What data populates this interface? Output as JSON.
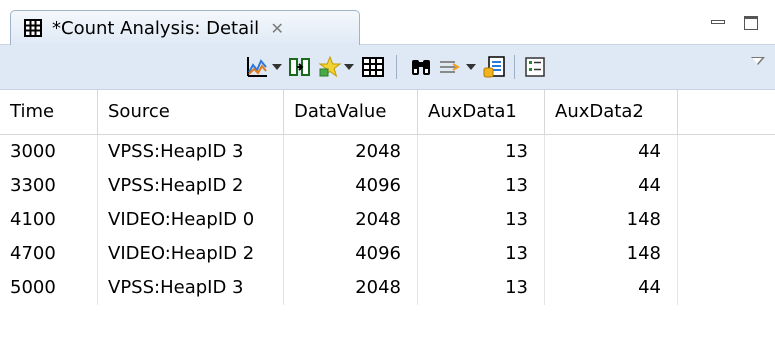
{
  "tab": {
    "title": "*Count Analysis: Detail",
    "icon": "table-icon",
    "close": "✕"
  },
  "window_controls": [
    "minimize",
    "maximize"
  ],
  "toolbar": {
    "icons": [
      "graph-icon",
      "columns-icon",
      "highlight-icon",
      "table-view-icon",
      "find-icon",
      "filter-icon",
      "export-icon",
      "group-icon",
      "view-menu-icon"
    ]
  },
  "table": {
    "columns": [
      "Time",
      "Source",
      "DataValue",
      "AuxData1",
      "AuxData2"
    ],
    "rows": [
      {
        "time": "3000",
        "source": "VPSS:HeapID 3",
        "datavalue": "2048",
        "aux1": "13",
        "aux2": "44"
      },
      {
        "time": "3300",
        "source": "VPSS:HeapID 2",
        "datavalue": "4096",
        "aux1": "13",
        "aux2": "44"
      },
      {
        "time": "4100",
        "source": "VIDEO:HeapID 0",
        "datavalue": "2048",
        "aux1": "13",
        "aux2": "148"
      },
      {
        "time": "4700",
        "source": "VIDEO:HeapID 2",
        "datavalue": "4096",
        "aux1": "13",
        "aux2": "148"
      },
      {
        "time": "5000",
        "source": "VPSS:HeapID 3",
        "datavalue": "2048",
        "aux1": "13",
        "aux2": "44"
      }
    ]
  },
  "colors": {
    "tab_bg": "#dfe9f5",
    "toolbar_bg": "#dfe9f5",
    "grid_line": "#d8d8d8"
  }
}
